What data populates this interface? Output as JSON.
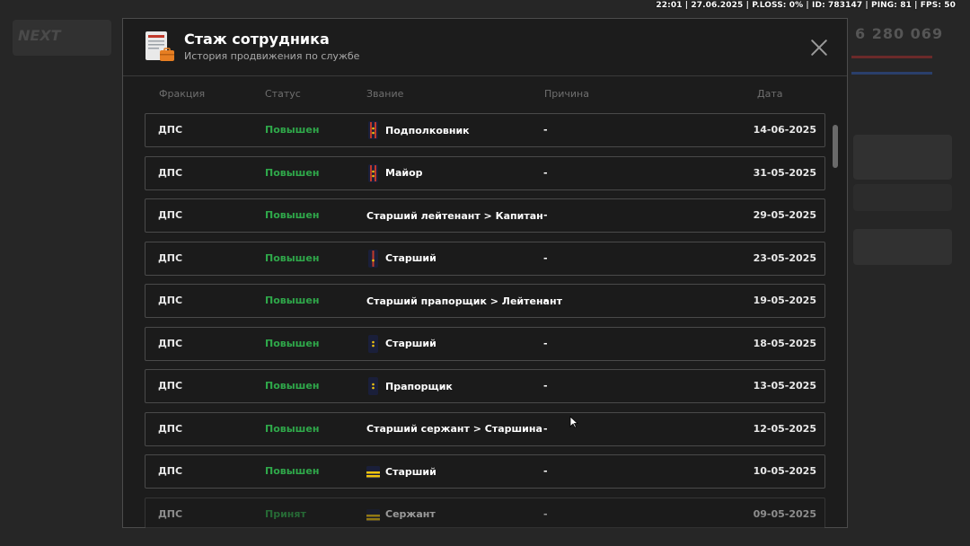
{
  "status_bar": {
    "text": "22:01 | 27.06.2025 | P.LOSS: 0% | ID: 783147 | PING: 81 | FPS: 50"
  },
  "background": {
    "logo": "NEXT",
    "money": "6 280 069"
  },
  "modal": {
    "title": "Стаж сотрудника",
    "subtitle": "История продвижения по службе",
    "columns": {
      "fraction": "Фракция",
      "status": "Статус",
      "rank": "Звание",
      "reason": "Причина",
      "date": "Дата"
    },
    "rows": [
      {
        "fraction": "ДПС",
        "status": "Повышен",
        "rank": "Подполковник",
        "rank_icon": "epaulette-red-two-stripes-icon",
        "reason": "-",
        "date": "14-06-2025"
      },
      {
        "fraction": "ДПС",
        "status": "Повышен",
        "rank": "Майор",
        "rank_icon": "epaulette-red-two-stripes-icon",
        "reason": "-",
        "date": "31-05-2025"
      },
      {
        "fraction": "ДПС",
        "status": "Повышен",
        "rank": "Старший лейтенант > Капитан",
        "rank_icon": "",
        "reason": "-",
        "date": "29-05-2025"
      },
      {
        "fraction": "ДПС",
        "status": "Повышен",
        "rank": "Старший",
        "rank_icon": "epaulette-red-one-stripe-icon",
        "reason": "-",
        "date": "23-05-2025"
      },
      {
        "fraction": "ДПС",
        "status": "Повышен",
        "rank": "Старший прапорщик > Лейтенант",
        "rank_icon": "",
        "reason": "-",
        "date": "19-05-2025"
      },
      {
        "fraction": "ДПС",
        "status": "Повышен",
        "rank": "Старший",
        "rank_icon": "epaulette-navy-stars-icon",
        "reason": "-",
        "date": "18-05-2025"
      },
      {
        "fraction": "ДПС",
        "status": "Повышен",
        "rank": "Прапорщик",
        "rank_icon": "epaulette-navy-stars-icon",
        "reason": "-",
        "date": "13-05-2025"
      },
      {
        "fraction": "ДПС",
        "status": "Повышен",
        "rank": "Старший сержант > Старшина",
        "rank_icon": "",
        "reason": "-",
        "date": "12-05-2025"
      },
      {
        "fraction": "ДПС",
        "status": "Повышен",
        "rank": "Старший",
        "rank_icon": "epaulette-yellow-stripes-icon",
        "reason": "-",
        "date": "10-05-2025"
      },
      {
        "fraction": "ДПС",
        "status": "Принят",
        "rank": "Сержант",
        "rank_icon": "epaulette-yellow-stripes-icon",
        "reason": "-",
        "date": "09-05-2025"
      }
    ]
  },
  "colors": {
    "promoted": "#2fa84a",
    "accent_red": "#c0392b",
    "rank_yellow": "#f1c40f",
    "rank_navy": "#1f2a5c"
  }
}
